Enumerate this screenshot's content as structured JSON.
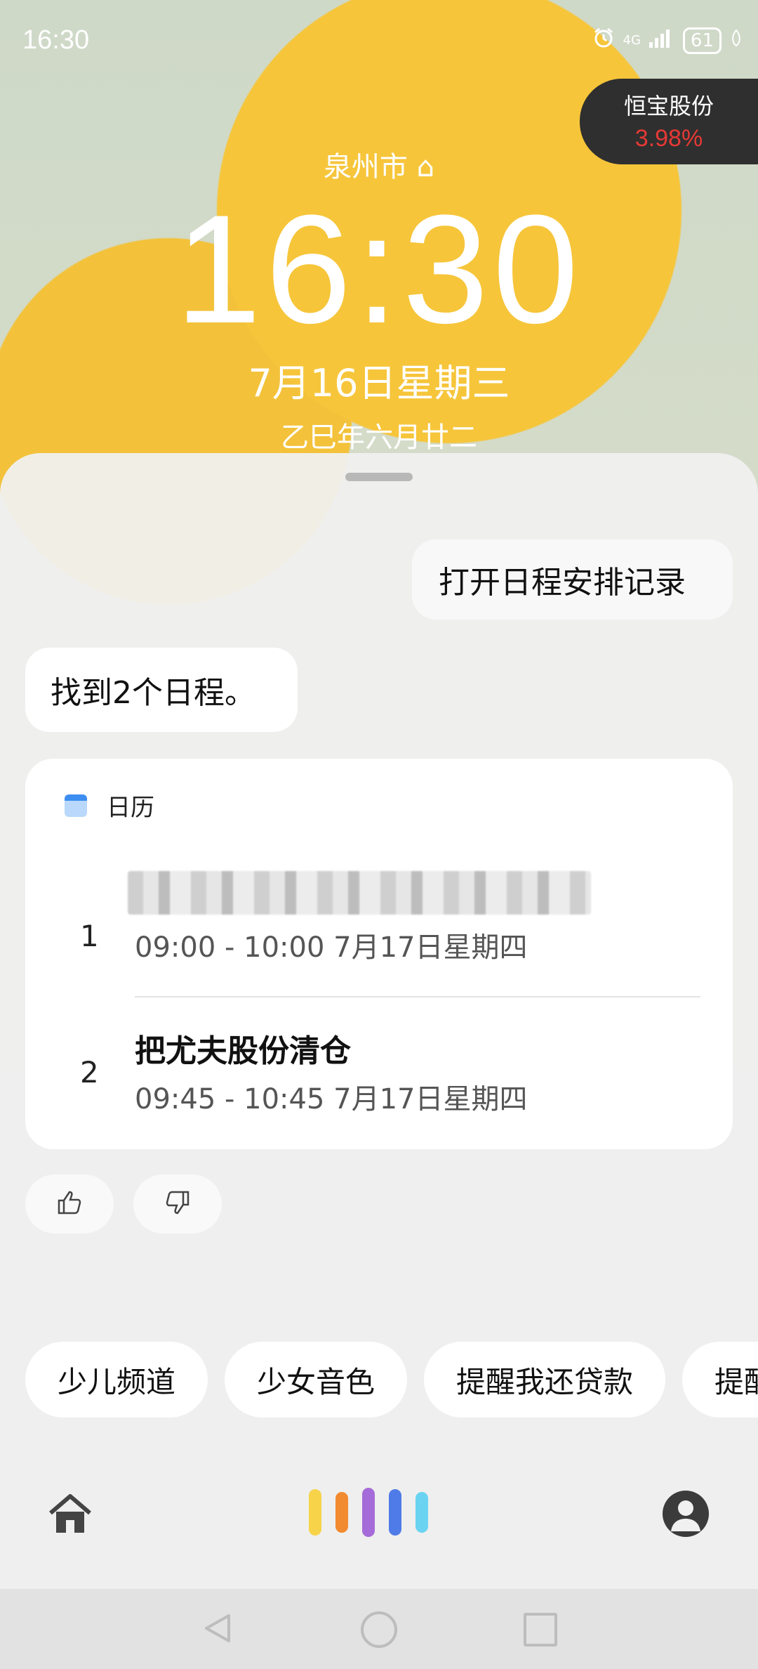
{
  "status_bar": {
    "time": "16:30",
    "network": "4G",
    "battery": "61"
  },
  "stock_widget": {
    "name": "恒宝股份",
    "change": "3.98%"
  },
  "lock_screen": {
    "city": "泉州市",
    "time": "16:30",
    "date": "7月16日星期三",
    "lunar": "乙巳年六月廿二"
  },
  "conversation": {
    "user_message": "打开日程安排记录",
    "assistant_message": "找到2个日程。"
  },
  "calendar_card": {
    "app_name": "日历",
    "events": [
      {
        "index": "1",
        "title": "",
        "time": "09:00 - 10:00 7月17日星期四"
      },
      {
        "index": "2",
        "title": "把尤夫股份清仓",
        "time": "09:45 - 10:45 7月17日星期四"
      }
    ]
  },
  "suggestions": [
    "少儿频道",
    "少女音色",
    "提醒我还贷款",
    "提醒"
  ],
  "icons": {
    "thumbs_up": "thumbs-up-icon",
    "thumbs_down": "thumbs-down-icon",
    "home": "home-icon",
    "voice": "voice-wave-icon",
    "profile": "profile-icon"
  },
  "colors": {
    "stock_red": "#e53935",
    "wave": [
      "#f7d34a",
      "#f28a2f",
      "#a56bd8",
      "#4f7be8",
      "#6ad3f2"
    ]
  }
}
